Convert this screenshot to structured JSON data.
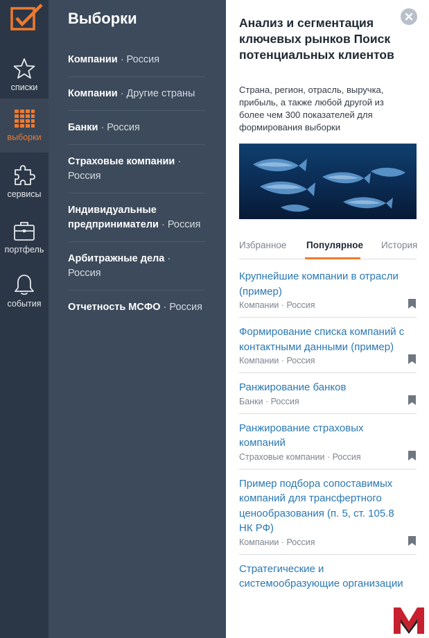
{
  "rail": {
    "items": [
      {
        "label": "списки",
        "icon": "star-icon"
      },
      {
        "label": "выборки",
        "icon": "grid-icon"
      },
      {
        "label": "сервисы",
        "icon": "puzzle-icon"
      },
      {
        "label": "портфель",
        "icon": "briefcase-icon"
      },
      {
        "label": "события",
        "icon": "bell-icon"
      }
    ]
  },
  "selections": {
    "title": "Выборки",
    "items": [
      {
        "name": "Компании",
        "country": "· Россия"
      },
      {
        "name": "Компании",
        "country": "· Другие страны"
      },
      {
        "name": "Банки",
        "country": "· Россия"
      },
      {
        "name": "Страховые компании",
        "country": "· Россия"
      },
      {
        "name": "Индивидуальные предприниматели",
        "country": "· Россия"
      },
      {
        "name": "Арбитражные дела",
        "country": "· Россия"
      },
      {
        "name": "Отчетность МСФО",
        "country": "· Россия"
      }
    ]
  },
  "detail": {
    "title": "Анализ и сегментация ключевых рынков Поиск потенциальных клиентов",
    "description": "Страна, регион, отрасль, выручка, прибыль, а также любой другой из более чем 300 показателей для формирования выборки",
    "tabs": [
      {
        "label": "Избранное",
        "active": false
      },
      {
        "label": "Популярное",
        "active": true
      },
      {
        "label": "История",
        "active": false
      }
    ],
    "results": [
      {
        "title": "Крупнейшие компании в отрасли (пример)",
        "meta": "Компании · Россия"
      },
      {
        "title": "Формирование списка компаний с контактными данными (пример)",
        "meta": "Компании · Россия"
      },
      {
        "title": "Ранжирование банков",
        "meta": "Банки · Россия"
      },
      {
        "title": "Ранжирование страховых компаний",
        "meta": "Страховые компании · Россия"
      },
      {
        "title": "Пример подбора сопоставимых компаний для трансфертного ценообразования (п. 5, ст. 105.8 НК РФ)",
        "meta": "Компании · Россия"
      },
      {
        "title": "Стратегические и системообразующие организации",
        "meta": ""
      }
    ]
  },
  "colors": {
    "rail_bg": "#2b3746",
    "panel_bg": "#3c4a5b",
    "accent": "#ef7a2e",
    "link": "#2a78b3",
    "brand_red": "#c8202e"
  }
}
